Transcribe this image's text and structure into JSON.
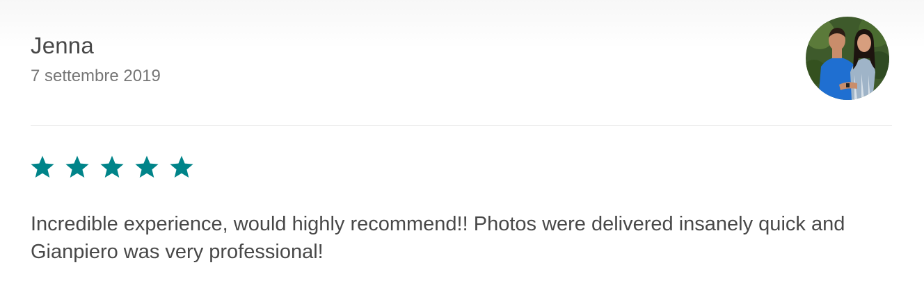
{
  "review": {
    "reviewer_name": "Jenna",
    "date": "7 settembre 2019",
    "avatar_icon": "avatar-photo-couple",
    "rating": {
      "value": 5,
      "max": 5,
      "star_icon": "star-icon",
      "color": "#008489"
    },
    "text": "Incredible experience, would highly recommend!! Photos were delivered insanely quick and Gianpiero was very professional!"
  }
}
